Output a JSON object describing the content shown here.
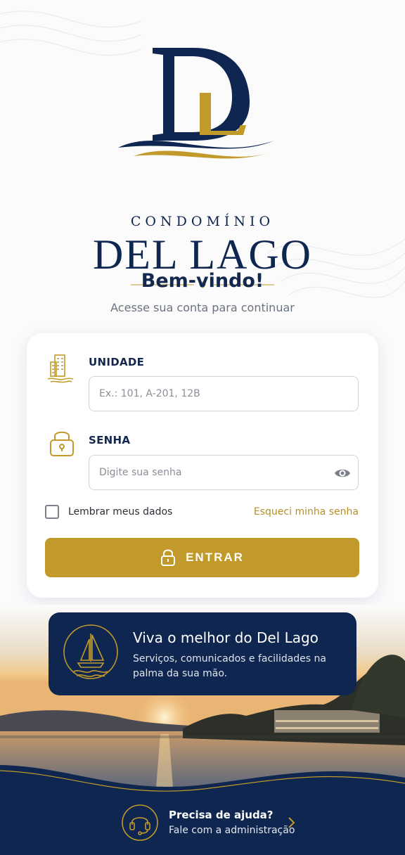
{
  "brand": {
    "monogram": "DL",
    "subtitle": "CONDOMÍNIO",
    "name": "DEL LAGO"
  },
  "welcome": {
    "title": "Bem-vindo!",
    "subtitle": "Acesse sua conta para continuar"
  },
  "form": {
    "unit": {
      "label": "UNIDADE",
      "placeholder": "Ex.: 101, A-201, 12B",
      "value": "",
      "icon": "building-icon"
    },
    "password": {
      "label": "SENHA",
      "placeholder": "Digite sua senha",
      "value": "",
      "icon": "lock-icon"
    },
    "remember": {
      "label": "Lembrar meus dados",
      "checked": false
    },
    "forgot_label": "Esqueci minha senha",
    "submit_label": "ENTRAR"
  },
  "banner": {
    "title": "Viva o melhor do Del Lago",
    "text": "Serviços, comunicados e facilidades na palma da sua mão.",
    "icon": "sailboat-icon"
  },
  "help": {
    "title": "Precisa de ajuda?",
    "subtitle": "Fale com a administração",
    "icon": "headset-icon"
  },
  "colors": {
    "navy": "#0f2650",
    "gold": "#c19a2b",
    "background": "#fbfbfc"
  }
}
